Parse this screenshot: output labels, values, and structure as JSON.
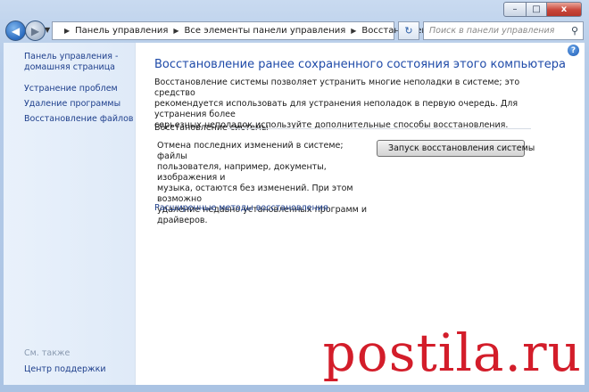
{
  "window": {
    "minimize_glyph": "–",
    "maximize_glyph": "□",
    "close_glyph": "x"
  },
  "navbar": {
    "breadcrumbs": [
      "Панель управления",
      "Все элементы панели управления",
      "Восстановление"
    ],
    "search_placeholder": "Поиск в панели управления"
  },
  "sidebar": {
    "home_line1": "Панель управления -",
    "home_line2": "домашняя страница",
    "links": [
      "Устранение проблем",
      "Удаление программы",
      "Восстановление файлов"
    ],
    "see_also_label": "См. также",
    "support_center": "Центр поддержки"
  },
  "main": {
    "title": "Восстановление ранее сохраненного состояния этого компьютера",
    "description_lines": [
      "Восстановление системы позволяет устранить многие неполадки в системе; это средство",
      "рекомендуется использовать для устранения неполадок в первую очередь. Для устранения более",
      "серьезных неполадок используйте дополнительные способы восстановления."
    ],
    "section_title": "Восстановление системы",
    "section_text_lines": [
      "Отмена последних изменений в системе; файлы",
      "пользователя, например, документы, изображения и",
      "музыка, остаются без изменений. При этом возможно",
      "удаление недавно установленных программ и",
      "драйверов."
    ],
    "restore_button": "Запуск восстановления системы",
    "advanced_link": "Расширенные методы восстановления"
  },
  "watermark": "postila.ru",
  "colors": {
    "accent_link": "#1e3f8c",
    "title_blue": "#1e4aa8",
    "watermark_red": "#d31d2a"
  }
}
